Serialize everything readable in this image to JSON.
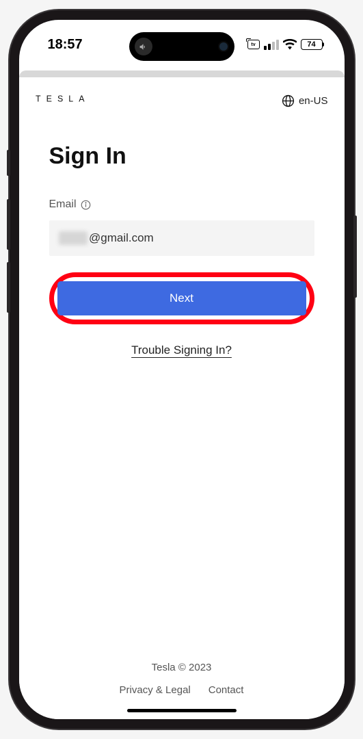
{
  "status": {
    "time": "18:57",
    "battery": "74",
    "carrier_label": "tv"
  },
  "header": {
    "logo": "T E S L A",
    "lang": "en-US"
  },
  "signin": {
    "title": "Sign In",
    "email_label": "Email",
    "email_local_masked": "xxxxx",
    "email_domain": "@gmail.com",
    "next_label": "Next",
    "trouble_label": "Trouble Signing In?"
  },
  "footer": {
    "copyright": "Tesla © 2023",
    "privacy": "Privacy & Legal",
    "contact": "Contact"
  }
}
